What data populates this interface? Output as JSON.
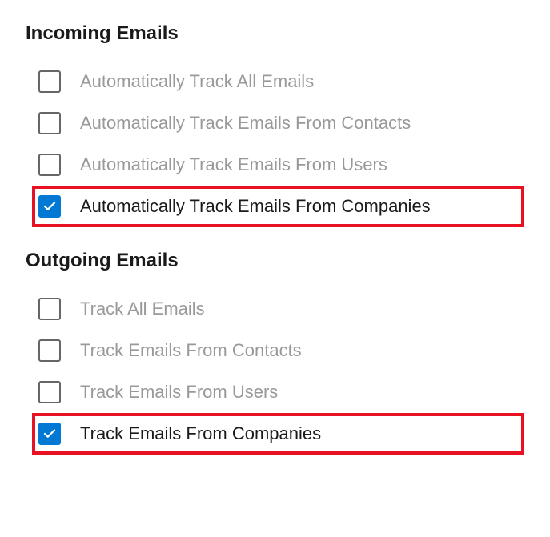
{
  "sections": [
    {
      "title": "Incoming Emails",
      "options": [
        {
          "label": "Automatically Track All Emails",
          "checked": false,
          "highlighted": false
        },
        {
          "label": "Automatically Track Emails From Contacts",
          "checked": false,
          "highlighted": false
        },
        {
          "label": "Automatically Track Emails From Users",
          "checked": false,
          "highlighted": false
        },
        {
          "label": "Automatically Track Emails From Companies",
          "checked": true,
          "highlighted": true
        }
      ]
    },
    {
      "title": "Outgoing Emails",
      "options": [
        {
          "label": "Track All Emails",
          "checked": false,
          "highlighted": false
        },
        {
          "label": "Track Emails From Contacts",
          "checked": false,
          "highlighted": false
        },
        {
          "label": "Track Emails From Users",
          "checked": false,
          "highlighted": false
        },
        {
          "label": "Track Emails From Companies",
          "checked": true,
          "highlighted": true
        }
      ]
    }
  ]
}
